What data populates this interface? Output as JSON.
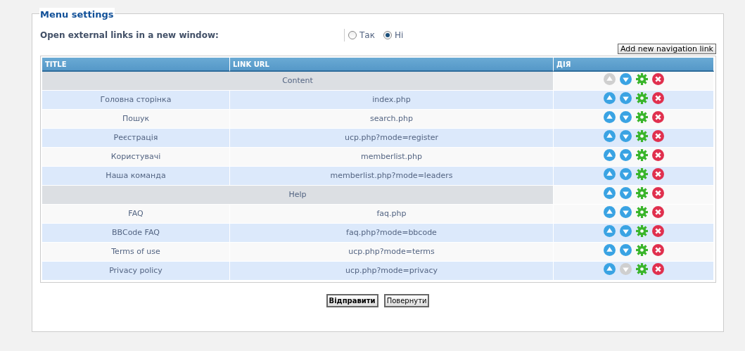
{
  "panel": {
    "legend": "Menu settings"
  },
  "option": {
    "label": "Open external links in a new window:",
    "choices": [
      {
        "label": "Так",
        "selected": false
      },
      {
        "label": "Ні",
        "selected": true
      }
    ]
  },
  "add_button": "Add new navigation link",
  "table": {
    "columns": [
      "TITLE",
      "LINK URL",
      "ДІЯ"
    ],
    "rows": [
      {
        "kind": "category",
        "title": "Content",
        "up_enabled": false,
        "down_enabled": true
      },
      {
        "kind": "link",
        "title": "Головна сторінка",
        "url": "index.php",
        "up_enabled": true,
        "down_enabled": true
      },
      {
        "kind": "link",
        "title": "Пошук",
        "url": "search.php",
        "up_enabled": true,
        "down_enabled": true
      },
      {
        "kind": "link",
        "title": "Реєстрація",
        "url": "ucp.php?mode=register",
        "up_enabled": true,
        "down_enabled": true
      },
      {
        "kind": "link",
        "title": "Користувачі",
        "url": "memberlist.php",
        "up_enabled": true,
        "down_enabled": true
      },
      {
        "kind": "link",
        "title": "Наша команда",
        "url": "memberlist.php?mode=leaders",
        "up_enabled": true,
        "down_enabled": true
      },
      {
        "kind": "category",
        "title": "Help",
        "up_enabled": true,
        "down_enabled": true
      },
      {
        "kind": "link",
        "title": "FAQ",
        "url": "faq.php",
        "up_enabled": true,
        "down_enabled": true
      },
      {
        "kind": "link",
        "title": "BBCode FAQ",
        "url": "faq.php?mode=bbcode",
        "up_enabled": true,
        "down_enabled": true
      },
      {
        "kind": "link",
        "title": "Terms of use",
        "url": "ucp.php?mode=terms",
        "up_enabled": true,
        "down_enabled": true
      },
      {
        "kind": "link",
        "title": "Privacy policy",
        "url": "ucp.php?mode=privacy",
        "up_enabled": true,
        "down_enabled": false
      }
    ]
  },
  "buttons": [
    {
      "kind": "primary",
      "label": "Відправити"
    },
    {
      "kind": "secondary",
      "label": "Повернути"
    }
  ]
}
